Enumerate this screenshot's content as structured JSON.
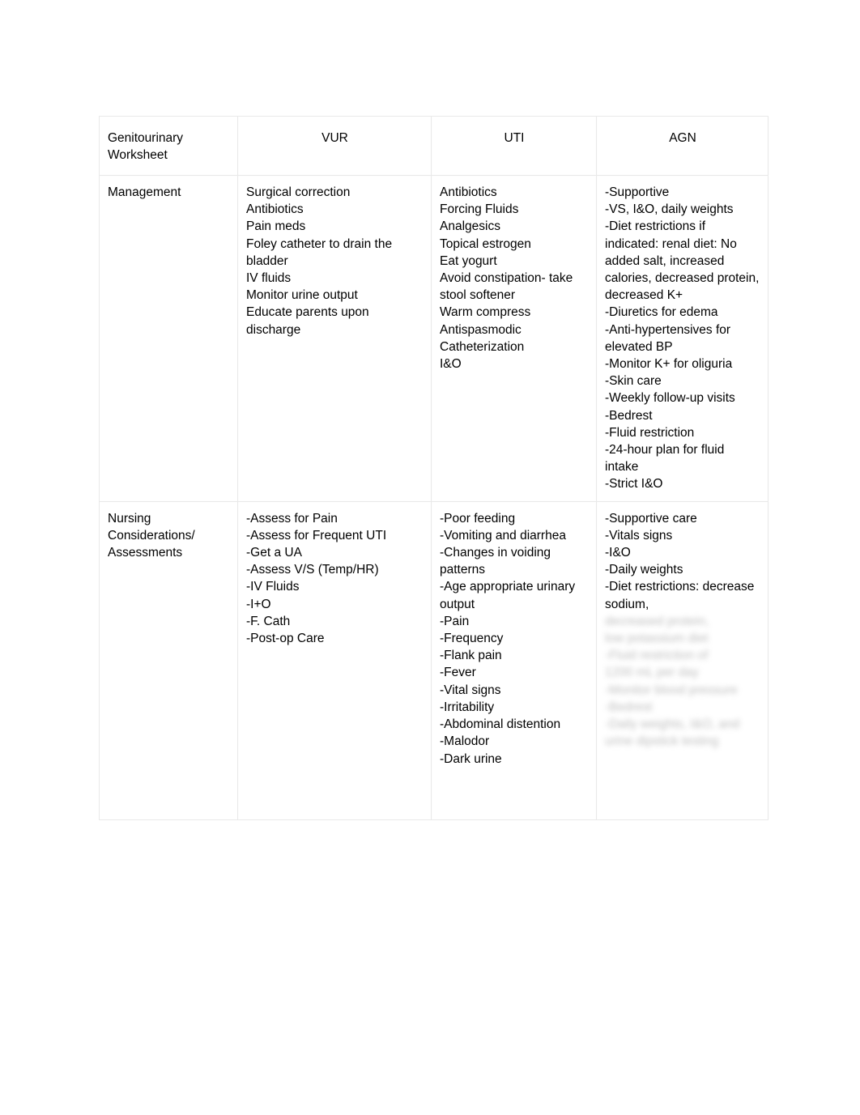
{
  "document": {
    "title": "Genitourinary Worksheet",
    "background_color": "#ffffff",
    "text_color": "#000000",
    "border_color": "#e9e9e9"
  },
  "table": {
    "headers": {
      "row_label": "Genitourinary\nWorksheet",
      "col_vur": "VUR",
      "col_uti": "UTI",
      "col_agn": "AGN"
    },
    "rows": [
      {
        "label": "Management",
        "vur": "Surgical correction\nAntibiotics\nPain meds\nFoley catheter to drain the bladder\nIV fluids\nMonitor urine output\nEducate parents upon discharge",
        "uti": "Antibiotics\nForcing Fluids\nAnalgesics\nTopical estrogen\nEat yogurt\nAvoid constipation- take stool softener\nWarm compress\nAntispasmodic\nCatheterization\nI&O",
        "agn": "-Supportive\n-VS, I&O, daily weights\n-Diet restrictions if indicated: renal diet: No added salt, increased calories, decreased protein, decreased K+\n-Diuretics for edema\n-Anti-hypertensives for elevated BP\n-Monitor K+ for oliguria\n-Skin care\n-Weekly follow-up visits\n-Bedrest\n-Fluid restriction\n-24-hour plan for fluid intake\n-Strict I&O",
        "agn_obscured": ""
      },
      {
        "label": "Nursing\nConsiderations/\nAssessments",
        "vur": "-Assess for Pain\n-Assess for Frequent UTI\n-Get a UA\n-Assess V/S (Temp/HR)\n-IV Fluids\n-I+O\n-F. Cath\n-Post-op Care",
        "uti": "-Poor feeding\n-Vomiting and diarrhea\n-Changes in voiding patterns\n-Age appropriate urinary output\n-Pain\n-Frequency\n-Flank pain\n-Fever\n-Vital signs\n-Irritability\n-Abdominal distention\n-Malodor\n-Dark urine",
        "agn": "-Supportive care\n-Vitals signs\n-I&O\n-Daily weights\n-Diet restrictions: decrease sodium,",
        "agn_obscured": "decreased protein,\nlow potassium diet\n-Fluid restriction of\n1200 mL per day\n-Monitor blood pressure\n-Bedrest\n-Daily weights, I&O, and\nurine dipstick testing"
      }
    ]
  }
}
